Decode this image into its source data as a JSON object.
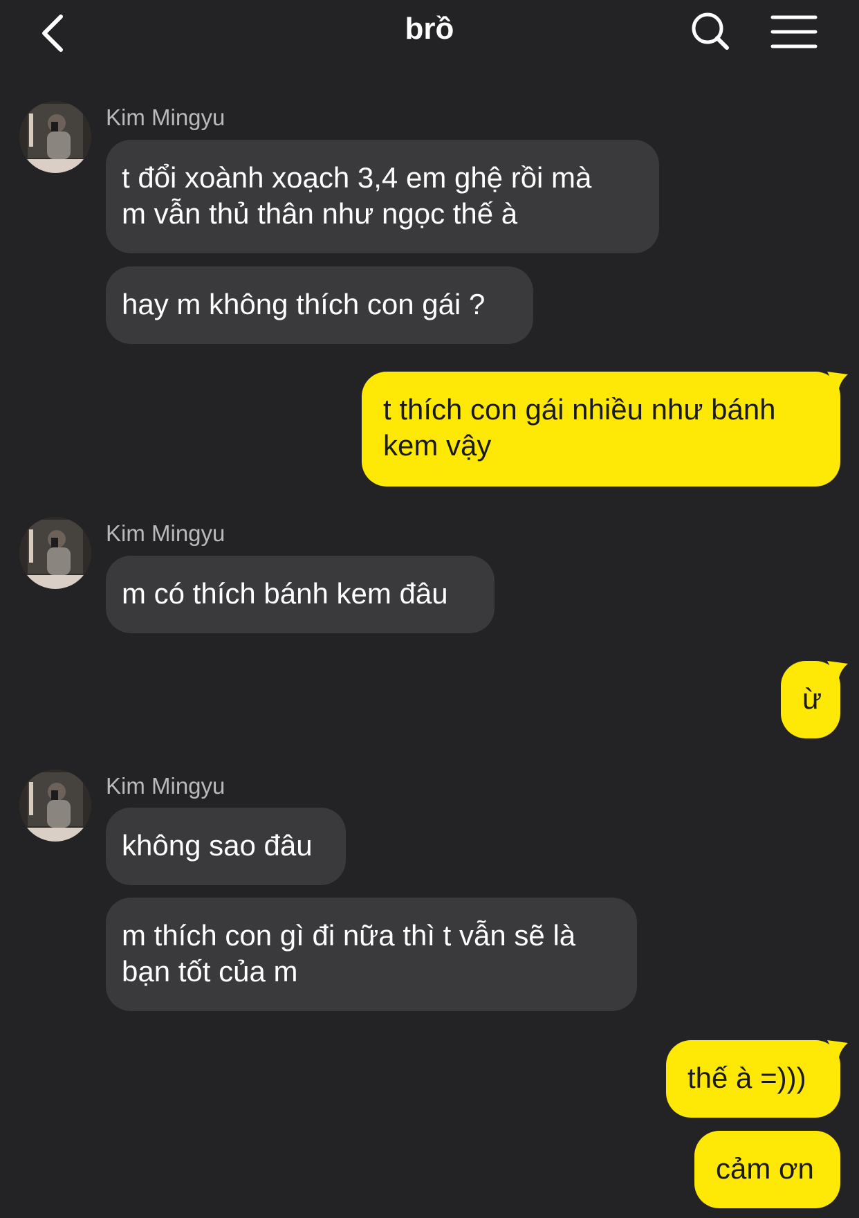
{
  "header": {
    "title": "brồ",
    "back_icon": "chevron-left-icon",
    "search_icon": "search-icon",
    "menu_icon": "hamburger-menu-icon"
  },
  "colors": {
    "background": "#232325",
    "incoming_bubble": "#3a3a3c",
    "outgoing_bubble": "#fde806",
    "sender_name": "#b9b9bb"
  },
  "messages": [
    {
      "direction": "in",
      "sender": "Kim Mingyu",
      "text": "t đổi xoành xoạch 3,4 em ghệ rồi mà\nm vẫn thủ thân như ngọc thế à"
    },
    {
      "direction": "in",
      "text": "hay m không thích con gái ?"
    },
    {
      "direction": "out",
      "text": "t thích con gái nhiều như bánh\nkem vậy"
    },
    {
      "direction": "in",
      "sender": "Kim Mingyu",
      "text": "m có thích bánh kem đâu"
    },
    {
      "direction": "out",
      "text": "ừ"
    },
    {
      "direction": "in",
      "sender": "Kim Mingyu",
      "text": "không sao đâu"
    },
    {
      "direction": "in",
      "text": "m thích con gì đi nữa thì t vẫn sẽ là\nbạn tốt của m"
    },
    {
      "direction": "out",
      "text": "thế à =)))"
    },
    {
      "direction": "out",
      "text": "cảm ơn"
    }
  ]
}
